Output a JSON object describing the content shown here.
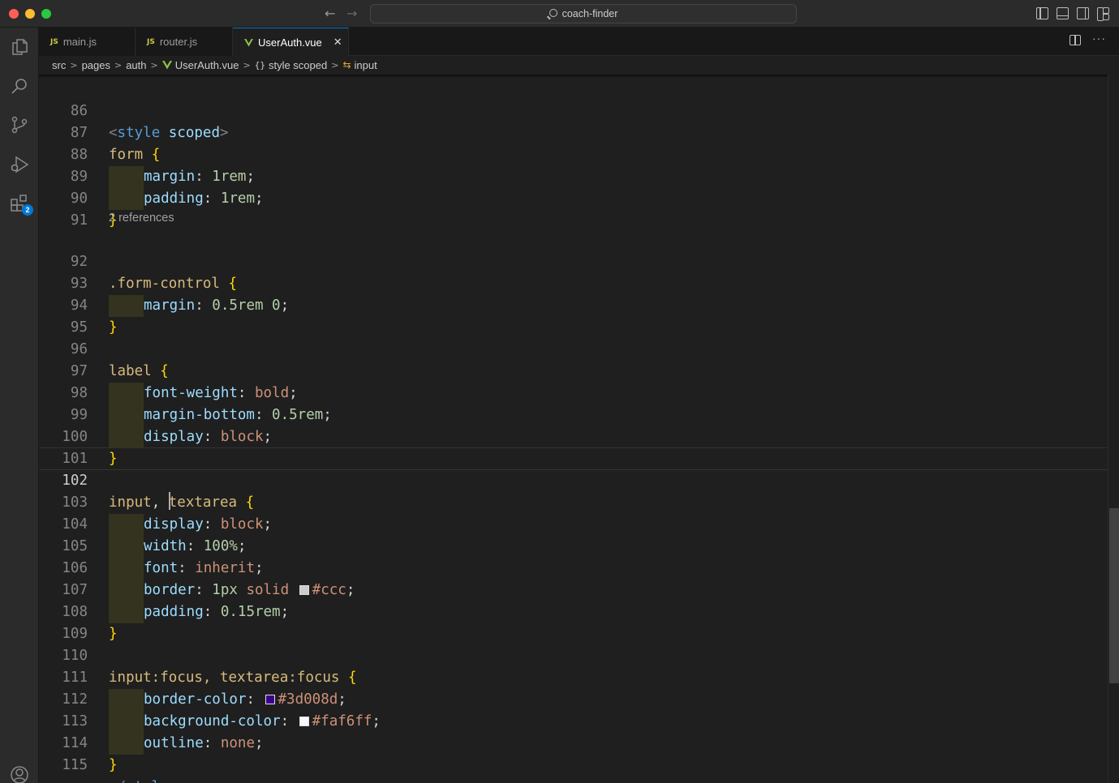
{
  "window": {
    "title": "coach-finder"
  },
  "tabs": [
    {
      "label": "main.js",
      "icon": "js-icon",
      "active": false
    },
    {
      "label": "router.js",
      "icon": "js-icon",
      "active": false
    },
    {
      "label": "UserAuth.vue",
      "icon": "vue-icon",
      "active": true
    }
  ],
  "tab_icon_glyphs": {
    "js": "JS",
    "close": "✕",
    "more": "···"
  },
  "nav": {
    "back": "←",
    "forward": "→"
  },
  "breadcrumb": {
    "items": [
      "src",
      "pages",
      "auth",
      "UserAuth.vue",
      "style scoped",
      "input"
    ],
    "separator": ">",
    "braces": "{}",
    "input_icon": "⇆"
  },
  "activity_bar": {
    "items": [
      "explorer-icon",
      "search-icon",
      "source-control-icon",
      "run-debug-icon",
      "extensions-icon"
    ],
    "extensions_badge": "2"
  },
  "editor": {
    "codelens": "2 references",
    "active_line": "102",
    "colors": {
      "ccc": "#cccccc",
      "3d008d": "#3d008d",
      "faf6ff": "#faf6ff"
    },
    "lines": [
      {
        "n": "86",
        "t": {
          "a": "<",
          "b": "style",
          "c": " scoped",
          "d": ">"
        }
      },
      {
        "n": "87",
        "t": {
          "a": "form",
          "b": " {"
        }
      },
      {
        "n": "88",
        "t": {
          "a": "margin",
          "b": ": ",
          "c": "1rem",
          "d": ";"
        }
      },
      {
        "n": "89",
        "t": {
          "a": "padding",
          "b": ": ",
          "c": "1rem",
          "d": ";"
        }
      },
      {
        "n": "90",
        "t": {
          "a": "}"
        }
      },
      {
        "n": "91",
        "t": {}
      },
      {
        "n": "92",
        "t": {
          "a": ".form-control",
          "b": " {"
        }
      },
      {
        "n": "93",
        "t": {
          "a": "margin",
          "b": ": ",
          "c": "0.5rem 0",
          "d": ";"
        }
      },
      {
        "n": "94",
        "t": {
          "a": "}"
        }
      },
      {
        "n": "95",
        "t": {}
      },
      {
        "n": "96",
        "t": {
          "a": "label",
          "b": " {"
        }
      },
      {
        "n": "97",
        "t": {
          "a": "font-weight",
          "b": ": ",
          "c": "bold",
          "d": ";"
        }
      },
      {
        "n": "98",
        "t": {
          "a": "margin-bottom",
          "b": ": ",
          "c": "0.5rem",
          "d": ";"
        }
      },
      {
        "n": "99",
        "t": {
          "a": "display",
          "b": ": ",
          "c": "block",
          "d": ";"
        }
      },
      {
        "n": "100",
        "t": {
          "a": "}"
        }
      },
      {
        "n": "101",
        "t": {}
      },
      {
        "n": "102",
        "t": {
          "a": "input",
          "b": ", ",
          "c": "textarea",
          "d": " {"
        }
      },
      {
        "n": "103",
        "t": {
          "a": "display",
          "b": ": ",
          "c": "block",
          "d": ";"
        }
      },
      {
        "n": "104",
        "t": {
          "a": "width",
          "b": ": ",
          "c": "100%",
          "d": ";"
        }
      },
      {
        "n": "105",
        "t": {
          "a": "font",
          "b": ": ",
          "c": "inherit",
          "d": ";"
        }
      },
      {
        "n": "106",
        "t": {
          "a": "border",
          "b": ": ",
          "c": "1px",
          "e": " solid ",
          "f": "#ccc",
          "d": ";"
        }
      },
      {
        "n": "107",
        "t": {
          "a": "padding",
          "b": ": ",
          "c": "0.15rem",
          "d": ";"
        }
      },
      {
        "n": "108",
        "t": {
          "a": "}"
        }
      },
      {
        "n": "109",
        "t": {}
      },
      {
        "n": "110",
        "t": {
          "a": "input:focus, textarea:focus",
          "b": " {"
        }
      },
      {
        "n": "111",
        "t": {
          "a": "border-color",
          "b": ": ",
          "f": "#3d008d",
          "d": ";"
        }
      },
      {
        "n": "112",
        "t": {
          "a": "background-color",
          "b": ": ",
          "f": "#faf6ff",
          "d": ";"
        }
      },
      {
        "n": "113",
        "t": {
          "a": "outline",
          "b": ": ",
          "c": "none",
          "d": ";"
        }
      },
      {
        "n": "114",
        "t": {
          "a": "}"
        }
      },
      {
        "n": "115",
        "t": {
          "a": "</",
          "b": "style",
          "d": ">"
        }
      }
    ]
  }
}
